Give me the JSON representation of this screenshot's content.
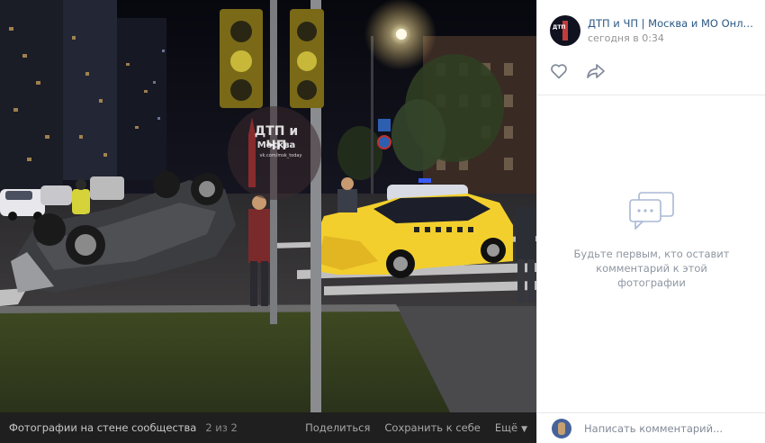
{
  "post": {
    "group_name": "ДТП и ЧП | Москва и МО Онлайн | ...",
    "time": "сегодня в 0:34",
    "avatar_text": "ДТП"
  },
  "photo": {
    "watermark_title": "ДТП и ЧП",
    "watermark_city": "Москва",
    "watermark_url": "vk.com/msk_today"
  },
  "actions": {
    "like_icon": "heart-icon",
    "share_icon": "share-arrow-icon"
  },
  "comments": {
    "empty_text": "Будьте первым, кто оставит комментарий к этой фотографии",
    "input_placeholder": "Написать комментарий..."
  },
  "bottom_bar": {
    "album_title": "Фотографии на стене сообщества",
    "counter": "2 из 2",
    "share": "Поделиться",
    "save": "Сохранить к себе",
    "more": "Ещё"
  },
  "colors": {
    "link": "#2a5885",
    "taxi": "#f2cf2d",
    "sidebar_bg": "#ffffff",
    "bar_bg": "#1f1f1f"
  }
}
